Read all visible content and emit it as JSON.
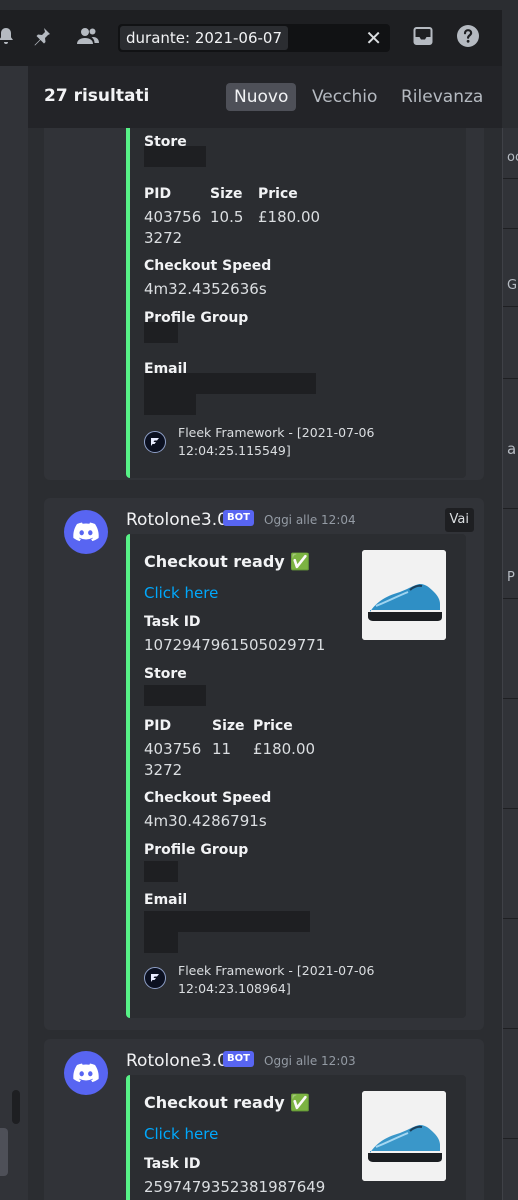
{
  "topbar": {
    "icons": [
      "bell-icon",
      "pin-icon",
      "members-icon",
      "inbox-icon",
      "help-icon"
    ],
    "search": {
      "value": "durante: 2021-06-07",
      "clear_glyph": "✕"
    }
  },
  "results": {
    "count_label": "27 risultati",
    "sort_tabs": [
      "Nuovo",
      "Vecchio",
      "Rilevanza"
    ],
    "active_sort": "Nuovo"
  },
  "right_strip": {
    "texts": [
      "oc",
      "GLI",
      "a",
      "P"
    ]
  },
  "messages": [
    {
      "embed": {
        "fields": [
          {
            "name": "Store",
            "value": ""
          },
          {
            "name": "PID",
            "value": "403756 3272"
          },
          {
            "name": "Size",
            "value": "10.5"
          },
          {
            "name": "Price",
            "value": "£180.00"
          },
          {
            "name": "Checkout Speed",
            "value": "4m32.4352636s"
          },
          {
            "name": "Profile Group",
            "value": ""
          },
          {
            "name": "Email",
            "value": ""
          }
        ],
        "footer": "Fleek Framework - [2021-07-06 12:04:25.115549]"
      }
    },
    {
      "author": "Rotolone3.0",
      "bot_tag": "BOT",
      "timestamp": "Oggi alle 12:04",
      "jump_label": "Vai",
      "embed": {
        "title": "Checkout ready ✅",
        "link": "Click here",
        "fields": [
          {
            "name": "Task ID",
            "value": "1072947961505029771"
          },
          {
            "name": "Store",
            "value": ""
          },
          {
            "name": "PID",
            "value": "403756 3272"
          },
          {
            "name": "Size",
            "value": "11"
          },
          {
            "name": "Price",
            "value": "£180.00"
          },
          {
            "name": "Checkout Speed",
            "value": "4m30.4286791s"
          },
          {
            "name": "Profile Group",
            "value": ""
          },
          {
            "name": "Email",
            "value": ""
          }
        ],
        "footer": "Fleek Framework - [2021-07-06 12:04:23.108964]"
      }
    },
    {
      "author": "Rotolone3.0",
      "bot_tag": "BOT",
      "timestamp": "Oggi alle 12:03",
      "embed": {
        "title": "Checkout ready ✅",
        "link": "Click here",
        "fields": [
          {
            "name": "Task ID",
            "value": "2597479352381987649"
          }
        ]
      }
    }
  ],
  "colors": {
    "accent": "#5865f2",
    "embed_bar": "#57f287",
    "link": "#00a8fc"
  }
}
